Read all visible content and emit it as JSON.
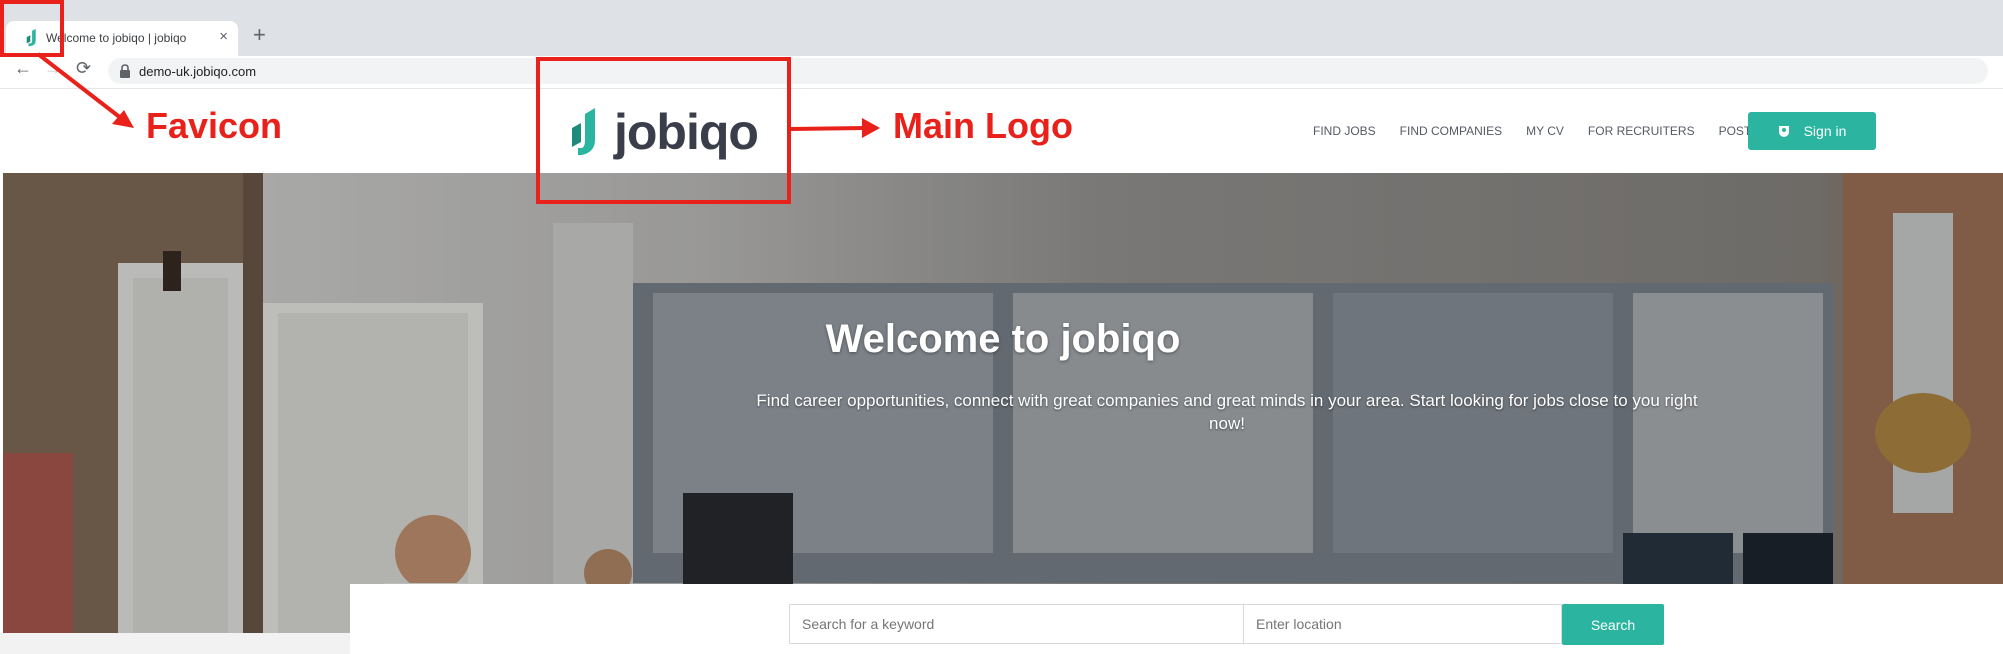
{
  "browser": {
    "tab_title": "Welcome to jobiqo | jobiqo",
    "tab_close": "×",
    "new_tab": "+",
    "back": "←",
    "forward": "→",
    "reload": "⟳",
    "url": "demo-uk.jobiqo.com"
  },
  "header": {
    "logo_text": "jobiqo",
    "nav": [
      "FIND JOBS",
      "FIND COMPANIES",
      "MY CV",
      "FOR RECRUITERS",
      "POST A JOB"
    ],
    "signin_label": "Sign in"
  },
  "hero": {
    "title": "Welcome to jobiqo",
    "subtitle": "Find career opportunities, connect with great companies and great minds in your area. Start looking for jobs close to you right now!"
  },
  "search": {
    "keyword_placeholder": "Search for a keyword",
    "location_placeholder": "Enter location",
    "button_label": "Search"
  },
  "annotations": {
    "favicon_label": "Favicon",
    "logo_label": "Main Logo"
  },
  "colors": {
    "brand_teal": "#2bb5a0",
    "annotation_red": "#e8211b"
  }
}
